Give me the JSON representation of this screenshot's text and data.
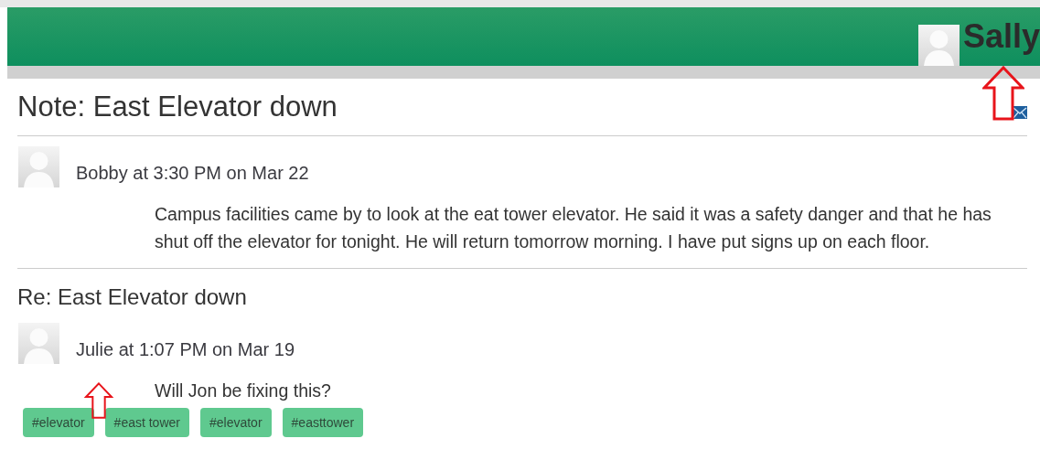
{
  "header": {
    "user_name": "Sally"
  },
  "note": {
    "title": "Note: East Elevator down",
    "post": {
      "meta": "Bobby at 3:30 PM on Mar 22",
      "body": "Campus facilities came by to look at the eat tower elevator. He said it was a safety danger and that he has shut off the elevator for tonight. He will return tomorrow morning. I have put signs up on each floor."
    }
  },
  "reply": {
    "title": "Re: East Elevator down",
    "post": {
      "meta": "Julie at 1:07 PM on Mar 19",
      "body": "Will Jon be fixing this?"
    }
  },
  "tags": [
    "#elevator",
    "#east tower",
    "#elevator",
    "#easttower"
  ]
}
